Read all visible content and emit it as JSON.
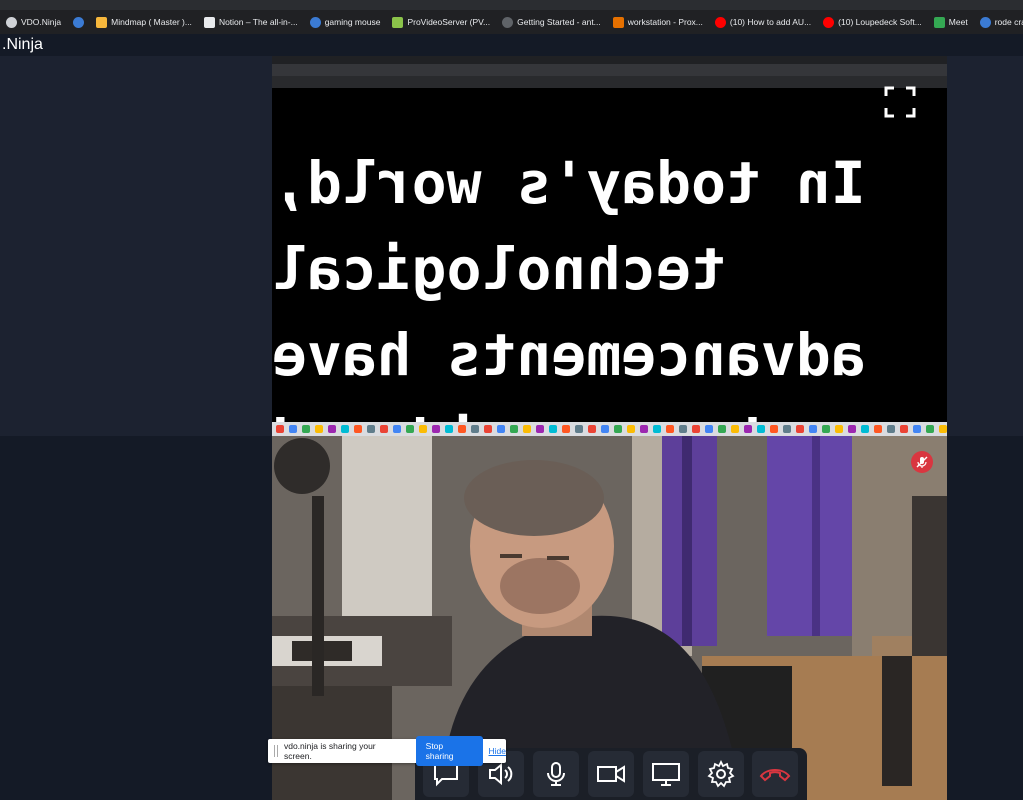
{
  "window": {
    "title": ".Ninja"
  },
  "bookmarks": [
    {
      "label": "VDO.Ninja",
      "icon": "vdo-ninja-icon",
      "color": "#cfd2d6"
    },
    {
      "label": "",
      "icon": "wordpress-icon",
      "color": "#3b7bd4"
    },
    {
      "label": "Mindmap ( Master )...",
      "icon": "mindmap-icon",
      "color": "#f6b73c"
    },
    {
      "label": "Notion – The all-in-...",
      "icon": "notion-icon",
      "color": "#e8eaed"
    },
    {
      "label": "gaming mouse",
      "icon": "wordpress-icon",
      "color": "#3b7bd4"
    },
    {
      "label": "ProVideoServer (PV...",
      "icon": "provideo-icon",
      "color": "#8bc34a"
    },
    {
      "label": "Getting Started - ant...",
      "icon": "github-icon",
      "color": "#5f6368"
    },
    {
      "label": "workstation - Prox...",
      "icon": "proxmox-icon",
      "color": "#e57000"
    },
    {
      "label": "(10) How to add AU...",
      "icon": "youtube-icon",
      "color": "#ff0000"
    },
    {
      "label": "(10) Loupedeck Soft...",
      "icon": "youtube-icon",
      "color": "#ff0000"
    },
    {
      "label": "Meet",
      "icon": "meet-icon",
      "color": "#34a853"
    },
    {
      "label": "rode crackling",
      "icon": "wordpress-icon",
      "color": "#3b7bd4"
    }
  ],
  "screenshare": {
    "caption_lines": [
      "In today's world,",
      "technological",
      "advancements have",
      "been rapid and"
    ]
  },
  "sharing_bar": {
    "message": "vdo.ninja is sharing your screen.",
    "stop_label": "Stop sharing",
    "hide_label": "Hide"
  },
  "controls": [
    {
      "name": "chat-button",
      "icon": "chat-icon"
    },
    {
      "name": "speaker-button",
      "icon": "speaker-icon"
    },
    {
      "name": "microphone-button",
      "icon": "microphone-icon"
    },
    {
      "name": "camera-button",
      "icon": "camera-icon"
    },
    {
      "name": "screenshare-button",
      "icon": "monitor-icon"
    },
    {
      "name": "settings-button",
      "icon": "gear-icon"
    },
    {
      "name": "hangup-button",
      "icon": "hangup-icon"
    }
  ],
  "colors": {
    "background": "#141a26",
    "panel": "#1c2230",
    "control_bar": "#1b1f27",
    "hangup": "#d93640",
    "accent_blue": "#1a73e8"
  }
}
